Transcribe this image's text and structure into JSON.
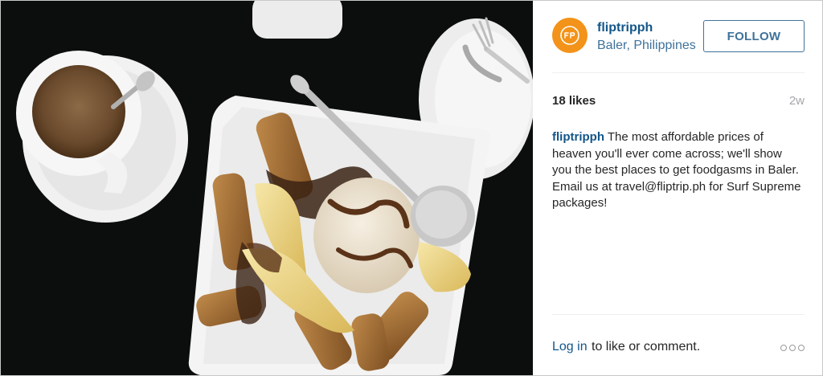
{
  "post": {
    "photo": {
      "icon": "food-photo",
      "colors": {
        "table": "#0c0d0d",
        "plate": "#f4f4f4",
        "coffee": "#6a4a2c"
      }
    },
    "header": {
      "username": "fliptripph",
      "location": "Baler, Philippines",
      "follow_label": "FOLLOW",
      "avatar_color": "#f39319"
    },
    "stats": {
      "likes": "18 likes",
      "age": "2w"
    },
    "caption": {
      "username": "fliptripph",
      "text": " The most affordable prices of heaven you'll ever come across; we'll show you the best places to get foodgasms in Baler. Email us at travel@fliptrip.ph for Surf Supreme packages!"
    },
    "footer": {
      "login_label": "Log in",
      "login_suffix": "to like or comment.",
      "more_icon": "more-options-icon"
    },
    "colors": {
      "link_blue": "#125688",
      "location_blue": "#3f729b",
      "muted_gray": "#a5a7aa"
    }
  }
}
